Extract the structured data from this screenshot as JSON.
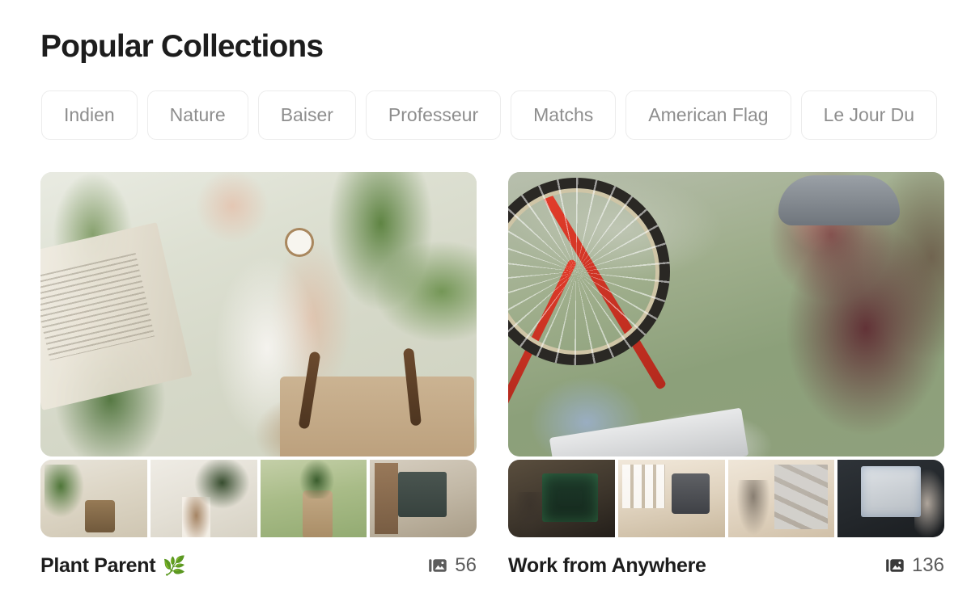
{
  "header": {
    "title": "Popular Collections"
  },
  "chips": [
    {
      "label": "Indien"
    },
    {
      "label": "Nature"
    },
    {
      "label": "Baiser"
    },
    {
      "label": "Professeur"
    },
    {
      "label": "Matchs"
    },
    {
      "label": "American Flag"
    },
    {
      "label": "Le Jour Du"
    }
  ],
  "collections": [
    {
      "title": "Plant Parent",
      "emoji": "🌿",
      "count": "56",
      "icon": "photos-stack-icon"
    },
    {
      "title": "Work from Anywhere",
      "emoji": "",
      "count": "136",
      "icon": "photos-stack-icon"
    }
  ],
  "colors": {
    "title_text": "#1d1d1d",
    "chip_text": "#8e8e8e",
    "chip_border": "#ececec",
    "count_text": "#5c5c5c",
    "background": "#ffffff"
  }
}
